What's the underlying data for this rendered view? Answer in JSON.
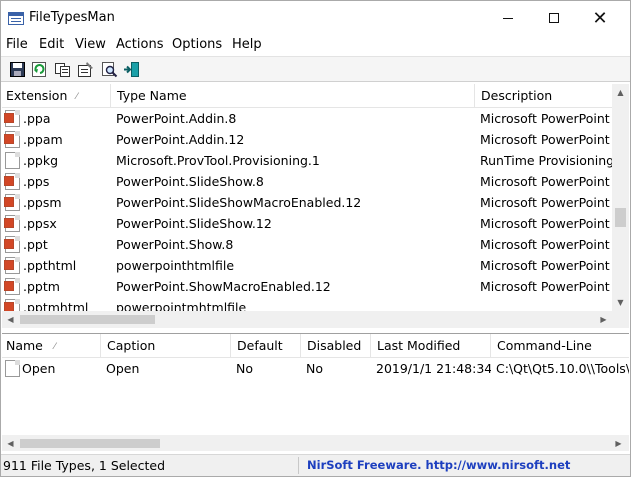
{
  "window": {
    "title": "FileTypesMan",
    "minimize_icon": "minimize-icon",
    "maximize_icon": "maximize-icon",
    "close_icon": "close-icon"
  },
  "menu": [
    "File",
    "Edit",
    "View",
    "Actions",
    "Options",
    "Help"
  ],
  "toolbar": [
    "save-icon",
    "refresh-icon",
    "copy-icon",
    "properties-icon",
    "find-icon",
    "exit-icon"
  ],
  "filetypes": {
    "columns": [
      "Extension",
      "Type Name",
      "Description"
    ],
    "sort_indicator": "⁄",
    "rows": [
      {
        "ext": ".ppa",
        "type": "PowerPoint.Addin.8",
        "desc": "Microsoft PowerPoint",
        "icon": "ppt-file-icon"
      },
      {
        "ext": ".ppam",
        "type": "PowerPoint.Addin.12",
        "desc": "Microsoft PowerPoint",
        "icon": "ppt-file-icon"
      },
      {
        "ext": ".ppkg",
        "type": "Microsoft.ProvTool.Provisioning.1",
        "desc": "RunTime Provisioning",
        "icon": "blank-file-icon"
      },
      {
        "ext": ".pps",
        "type": "PowerPoint.SlideShow.8",
        "desc": "Microsoft PowerPoint",
        "icon": "ppt-file-icon"
      },
      {
        "ext": ".ppsm",
        "type": "PowerPoint.SlideShowMacroEnabled.12",
        "desc": "Microsoft PowerPoint",
        "icon": "ppt-file-icon"
      },
      {
        "ext": ".ppsx",
        "type": "PowerPoint.SlideShow.12",
        "desc": "Microsoft PowerPoint",
        "icon": "ppt-file-icon"
      },
      {
        "ext": ".ppt",
        "type": "PowerPoint.Show.8",
        "desc": "Microsoft PowerPoint",
        "icon": "ppt-file-icon"
      },
      {
        "ext": ".ppthtml",
        "type": "powerpointhtmlfile",
        "desc": "Microsoft PowerPoint",
        "icon": "ppt-file-icon"
      },
      {
        "ext": ".pptm",
        "type": "PowerPoint.ShowMacroEnabled.12",
        "desc": "Microsoft PowerPoint",
        "icon": "ppt-file-icon"
      },
      {
        "ext": ".pptmhtml",
        "type": "powerpointmhtmlfile",
        "desc": "",
        "icon": "ppt-file-icon"
      }
    ]
  },
  "actions": {
    "columns": [
      "Name",
      "Caption",
      "Default",
      "Disabled",
      "Last Modified",
      "Command-Line"
    ],
    "sort_indicator": "⁄",
    "rows": [
      {
        "name": "Open",
        "caption": "Open",
        "default": "No",
        "disabled": "No",
        "modified": "2019/1/1 21:48:34",
        "cmd": "C:\\Qt\\Qt5.10.0\\\\Tools\\",
        "icon": "blank-file-icon"
      }
    ]
  },
  "status": {
    "count": "911 File Types, 1 Selected",
    "link": "NirSoft Freeware.  http://www.nirsoft.net"
  }
}
